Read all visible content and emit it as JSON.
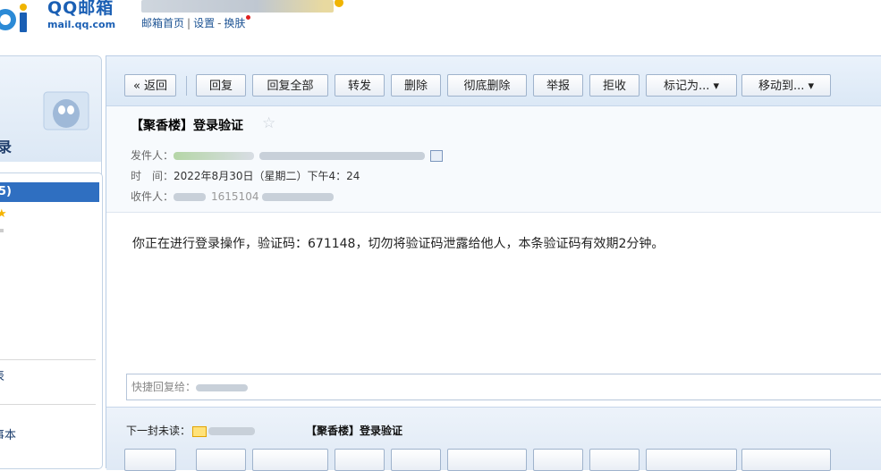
{
  "brand": {
    "name": "QQ邮箱",
    "domain": "mail.qq.com"
  },
  "topnav": {
    "home": "邮箱首页",
    "sep1": "|",
    "settings": "设置",
    "sep2": "-",
    "skin": "换肤"
  },
  "sidebar": {
    "top_label": "录",
    "selected_label": "5)",
    "item_a": "表",
    "item_b": "事本"
  },
  "toolbar": {
    "back": "« 返回",
    "reply": "回复",
    "reply_all": "回复全部",
    "forward": "转发",
    "delete": "删除",
    "delete_forever": "彻底删除",
    "report": "举报",
    "reject": "拒收",
    "mark_as": "标记为... ▾",
    "move_to": "移动到... ▾"
  },
  "mail": {
    "subject": "【聚香楼】登录验证",
    "from_label": "发件人：",
    "time_label": "时　间：",
    "time_value": "2022年8月30日（星期二）下午4：24",
    "to_label": "收件人：",
    "to_partial": "1615104",
    "body": "你正在进行登录操作，验证码：671148，切勿将验证码泄露给他人，本条验证码有效期2分钟。"
  },
  "quick_reply": {
    "label": "快捷回复给："
  },
  "next_unread": {
    "label": "下一封未读：",
    "subject": "【聚香楼】登录验证"
  },
  "colors": {
    "accent": "#2f6fc1",
    "toolbar_bg": "#dbe8f6",
    "link": "#1e5494"
  }
}
